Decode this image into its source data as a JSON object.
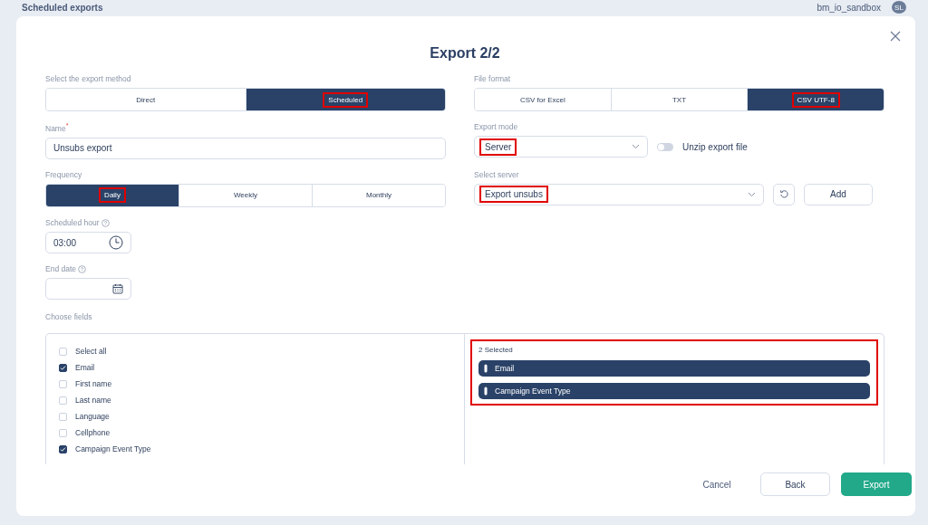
{
  "page_header": {
    "title": "Scheduled exports",
    "account": "bm_io_sandbox",
    "avatar": "SL"
  },
  "dialog": {
    "title": "Export 2/2",
    "export_method": {
      "label": "Select the export method",
      "options": [
        {
          "label": "Direct",
          "selected": false,
          "highlighted": false
        },
        {
          "label": "Scheduled",
          "selected": true,
          "highlighted": true
        }
      ]
    },
    "file_format": {
      "label": "File format",
      "options": [
        {
          "label": "CSV for Excel",
          "selected": false,
          "highlighted": false
        },
        {
          "label": "TXT",
          "selected": false,
          "highlighted": false
        },
        {
          "label": "CSV UTF-8",
          "selected": true,
          "highlighted": true
        }
      ]
    },
    "name": {
      "label": "Name",
      "required_mark": "*",
      "value": "Unsubs export"
    },
    "export_mode": {
      "label": "Export mode",
      "value": "Server",
      "highlighted": true
    },
    "unzip_toggle": {
      "label": "Unzip export file",
      "on": false
    },
    "frequency": {
      "label": "Frequency",
      "options": [
        {
          "label": "Daily",
          "selected": true,
          "highlighted": true
        },
        {
          "label": "Weekly",
          "selected": false,
          "highlighted": false
        },
        {
          "label": "Monthly",
          "selected": false,
          "highlighted": false
        }
      ]
    },
    "select_server": {
      "label": "Select server",
      "value": "Export unsubs",
      "highlighted": true,
      "add_button": "Add"
    },
    "scheduled_hour": {
      "label": "Scheduled hour",
      "value": "03:00"
    },
    "end_date": {
      "label": "End date"
    },
    "choose_fields": {
      "label": "Choose fields",
      "fields": [
        {
          "label": "Select all",
          "checked": false
        },
        {
          "label": "Email",
          "checked": true
        },
        {
          "label": "First name",
          "checked": false
        },
        {
          "label": "Last name",
          "checked": false
        },
        {
          "label": "Language",
          "checked": false
        },
        {
          "label": "Cellphone",
          "checked": false
        },
        {
          "label": "Campaign Event Type",
          "checked": true
        }
      ],
      "selected_panel": {
        "count": "2 Selected",
        "highlighted": true,
        "items": [
          "Email",
          "Campaign Event Type"
        ]
      }
    },
    "buttons": {
      "cancel": "Cancel",
      "back": "Back",
      "export": "Export"
    }
  }
}
